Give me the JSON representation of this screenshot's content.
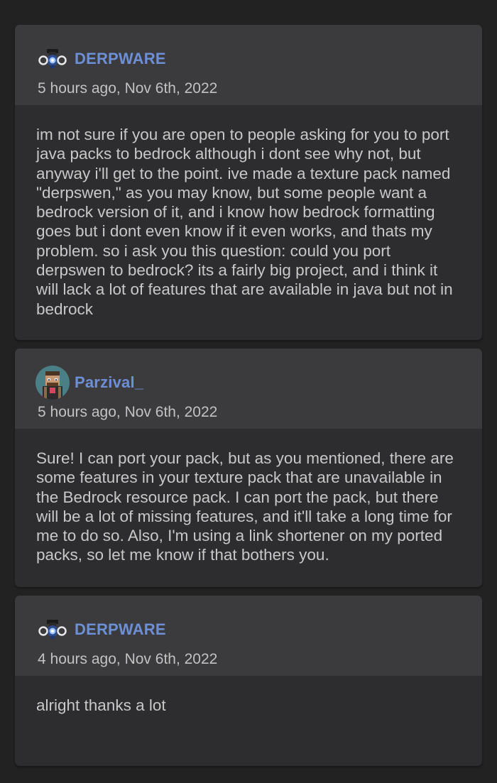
{
  "comments": [
    {
      "author": "DERPWARE",
      "avatar_icon": "robot-avatar-icon",
      "timestamp": "5 hours ago, Nov 6th, 2022",
      "body": "im not sure if you are open to people asking for you to port java packs to bedrock although i dont see why not, but anyway i'll get to the point. ive made a texture pack named \"derpswen,\" as you may know, but some people want a bedrock version of it, and i know how bedrock formatting goes but i dont even know if it even works, and thats my problem. so i ask you this question: could you port derpswen to bedrock? its a fairly big project, and i think it will lack a lot of features that are available in java but not in bedrock"
    },
    {
      "author": "Parzival_",
      "avatar_icon": "pixel-character-avatar-icon",
      "timestamp": "5 hours ago, Nov 6th, 2022",
      "body": "Sure! I can port your pack, but as you mentioned, there are some features in your texture pack that are unavailable in the Bedrock resource pack. I can port the pack, but there will be a lot of missing features, and it'll take a long time for me to do so. Also, I'm using a link shortener on my ported packs, so let me know if that bothers you."
    },
    {
      "author": "DERPWARE",
      "avatar_icon": "robot-avatar-icon",
      "timestamp": "4 hours ago, Nov 6th, 2022",
      "body": "alright thanks a lot"
    }
  ],
  "colors": {
    "background": "#222222",
    "card_body": "#2d2d2f",
    "card_header": "#3b3b3d",
    "username": "#6c8fd6",
    "text": "#c8c8c8"
  }
}
